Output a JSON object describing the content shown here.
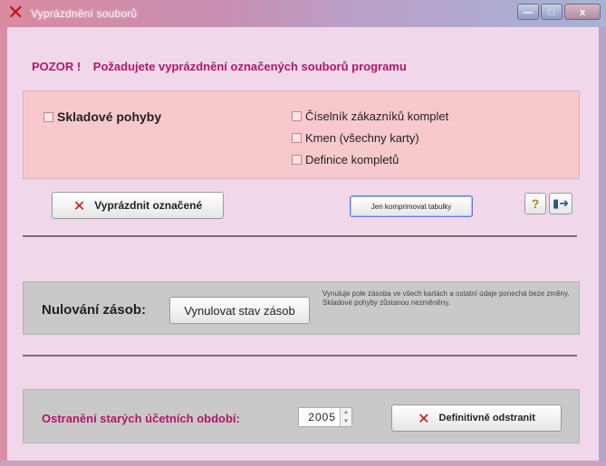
{
  "window": {
    "title": "Vyprázdnění souborů",
    "controls": {
      "minimize": "—",
      "maximize": "□",
      "close": "x"
    }
  },
  "warning": {
    "lead": "POZOR !",
    "message": "Požadujete vyprázdnění označených souborů programu"
  },
  "files": {
    "left": [
      {
        "label": "Skladové pohyby",
        "checked": false
      }
    ],
    "right": [
      {
        "label": "Číselník zákazníků komplet",
        "checked": false
      },
      {
        "label": "Kmen (všechny karty)",
        "checked": false
      },
      {
        "label": "Definice kompletů",
        "checked": false
      }
    ]
  },
  "toolbar": {
    "empty_label": "Vyprázdnit označené",
    "compress_label": "Jen komprimovat tabulky",
    "help_icon": "question-key-icon",
    "exit_icon": "exit-door-icon"
  },
  "reset": {
    "label": "Nulování zásob:",
    "button_label": "Vynulovat stav zásob",
    "note": "Vynuluje pole zásoba ve všech kartách a ostatní údaje ponechá beze změny. Skladové pohyby zůstanou nezměněny."
  },
  "old_periods": {
    "label": "Ostranění starých účetních období:",
    "year": "2005",
    "delete_label": "Definitivně odstranit"
  },
  "colors": {
    "background": "#f0d7ea",
    "panel_pink": "#f7c9cd",
    "panel_gray": "#c9c9c9",
    "accent": "#b0186a",
    "danger": "#c01010"
  }
}
